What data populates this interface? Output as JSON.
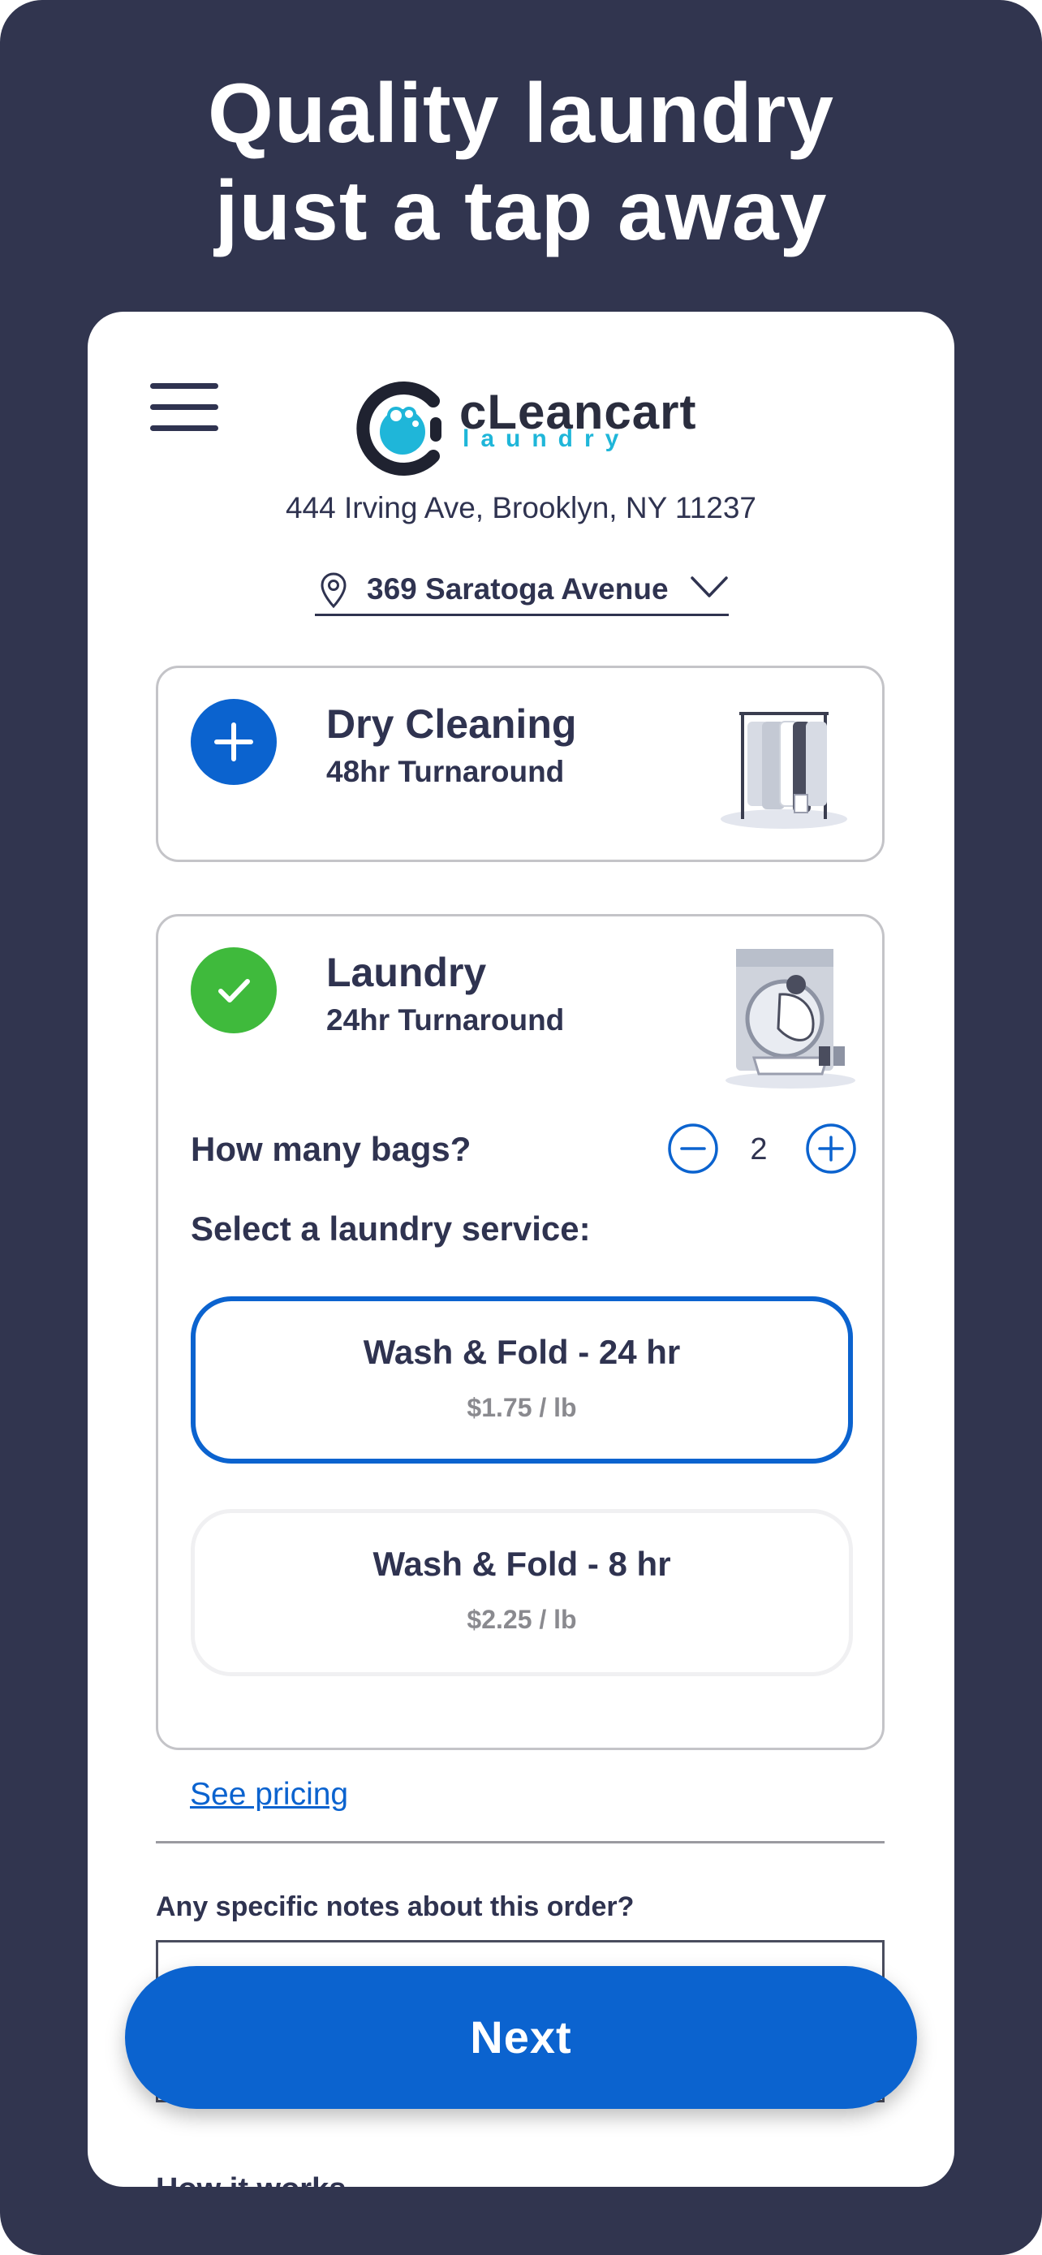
{
  "headline": {
    "line1": "Quality laundry",
    "line2": "just a tap away"
  },
  "header": {
    "brand_top": "cLeancart",
    "brand_bottom": "Laundry",
    "address": "444 Irving Ave, Brooklyn, NY 11237",
    "location_label": "369 Saratoga Avenue"
  },
  "services": {
    "dry_cleaning": {
      "title": "Dry Cleaning",
      "subtitle": "48hr Turnaround",
      "icon": "plus-icon"
    },
    "laundry": {
      "title": "Laundry",
      "subtitle": "24hr Turnaround",
      "icon": "check-icon"
    }
  },
  "bags": {
    "label": "How many bags?",
    "count": "2"
  },
  "laundry_service": {
    "label": "Select a laundry service:",
    "options": [
      {
        "name": "Wash & Fold - 24 hr",
        "price": "$1.75 / lb",
        "selected": true
      },
      {
        "name": "Wash & Fold - 8 hr",
        "price": "$2.25 / lb",
        "selected": false
      }
    ]
  },
  "links": {
    "pricing": "See pricing"
  },
  "notes": {
    "label": "Any specific notes about this order?"
  },
  "how_it_works": "How it works",
  "next_button": "Next",
  "colors": {
    "background": "#31354f",
    "accent": "#0b63cf",
    "check_green": "#3fba3c",
    "brand_cyan": "#1fb6d9",
    "text": "#2f3350"
  }
}
